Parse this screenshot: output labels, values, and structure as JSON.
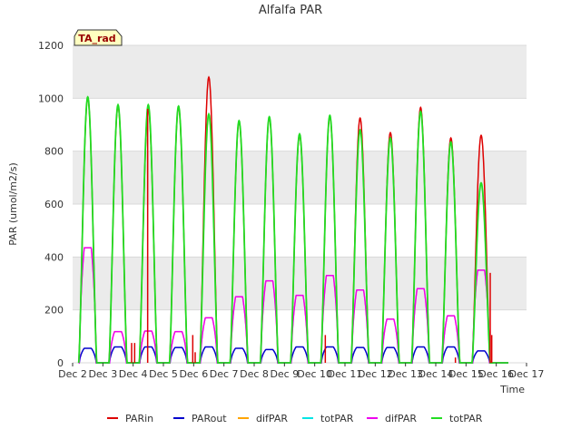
{
  "chart_data": {
    "type": "line",
    "title": "Alfalfa PAR",
    "xlabel": "Time",
    "ylabel": "PAR (umol/m2/s)",
    "annotation_box": "TA_rad",
    "ylim": [
      0,
      1200
    ],
    "xlim": [
      2,
      17
    ],
    "yticks": [
      0,
      200,
      400,
      600,
      800,
      1000,
      1200
    ],
    "xticks": [
      {
        "v": 2,
        "label": "Dec 2"
      },
      {
        "v": 3,
        "label": "Dec 3"
      },
      {
        "v": 4,
        "label": "Dec 4"
      },
      {
        "v": 5,
        "label": "Dec 5"
      },
      {
        "v": 6,
        "label": "Dec 6"
      },
      {
        "v": 7,
        "label": "Dec 7"
      },
      {
        "v": 8,
        "label": "Dec 8"
      },
      {
        "v": 9,
        "label": "Dec 9"
      },
      {
        "v": 10,
        "label": "Dec 10"
      },
      {
        "v": 11,
        "label": "Dec 11"
      },
      {
        "v": 12,
        "label": "Dec 12"
      },
      {
        "v": 13,
        "label": "Dec 13"
      },
      {
        "v": 14,
        "label": "Dec 14"
      },
      {
        "v": 15,
        "label": "Dec 15"
      },
      {
        "v": 16,
        "label": "Dec 16"
      },
      {
        "v": 17,
        "label": "Dec 17"
      }
    ],
    "grid": true,
    "legend_position": "bottom",
    "days": [
      {
        "center": 2.5,
        "par_in": 1000,
        "tot": 1005,
        "dif": 435,
        "par_out": 55
      },
      {
        "center": 3.5,
        "par_in": 970,
        "tot": 975,
        "dif": 118,
        "par_out": 60
      },
      {
        "center": 4.5,
        "par_in": 960,
        "tot": 975,
        "dif": 120,
        "par_out": 60
      },
      {
        "center": 5.5,
        "par_in": 965,
        "tot": 970,
        "dif": 118,
        "par_out": 58
      },
      {
        "center": 6.5,
        "par_in": 1080,
        "tot": 940,
        "dif": 170,
        "par_out": 60
      },
      {
        "center": 7.5,
        "par_in": 910,
        "tot": 915,
        "dif": 250,
        "par_out": 55
      },
      {
        "center": 8.5,
        "par_in": 925,
        "tot": 930,
        "dif": 310,
        "par_out": 50
      },
      {
        "center": 9.5,
        "par_in": 860,
        "tot": 865,
        "dif": 255,
        "par_out": 60
      },
      {
        "center": 10.5,
        "par_in": 930,
        "tot": 935,
        "dif": 330,
        "par_out": 60
      },
      {
        "center": 11.5,
        "par_in": 925,
        "tot": 880,
        "dif": 275,
        "par_out": 58
      },
      {
        "center": 12.5,
        "par_in": 870,
        "tot": 850,
        "dif": 165,
        "par_out": 58
      },
      {
        "center": 13.5,
        "par_in": 965,
        "tot": 950,
        "dif": 280,
        "par_out": 60
      },
      {
        "center": 14.5,
        "par_in": 850,
        "tot": 835,
        "dif": 178,
        "par_out": 60
      },
      {
        "center": 15.5,
        "par_in": 860,
        "tot": 680,
        "dif": 350,
        "par_out": 45
      }
    ],
    "spikes": [
      {
        "x": 3.95,
        "y": 75
      },
      {
        "x": 4.05,
        "y": 75
      },
      {
        "x": 4.48,
        "y": 960
      },
      {
        "x": 5.97,
        "y": 105
      },
      {
        "x": 6.05,
        "y": 40
      },
      {
        "x": 10.35,
        "y": 105
      },
      {
        "x": 14.65,
        "y": 20
      },
      {
        "x": 15.8,
        "y": 340
      },
      {
        "x": 15.85,
        "y": 105
      }
    ],
    "series": [
      {
        "name": "PARin",
        "color": "#dd0000"
      },
      {
        "name": "PARout",
        "color": "#0000cc"
      },
      {
        "name": "difPAR",
        "color": "#ffa500"
      },
      {
        "name": "totPAR",
        "color": "#00e5e5"
      },
      {
        "name": "difPAR",
        "color": "#ee00ee"
      },
      {
        "name": "totPAR",
        "color": "#22dd22"
      }
    ]
  }
}
